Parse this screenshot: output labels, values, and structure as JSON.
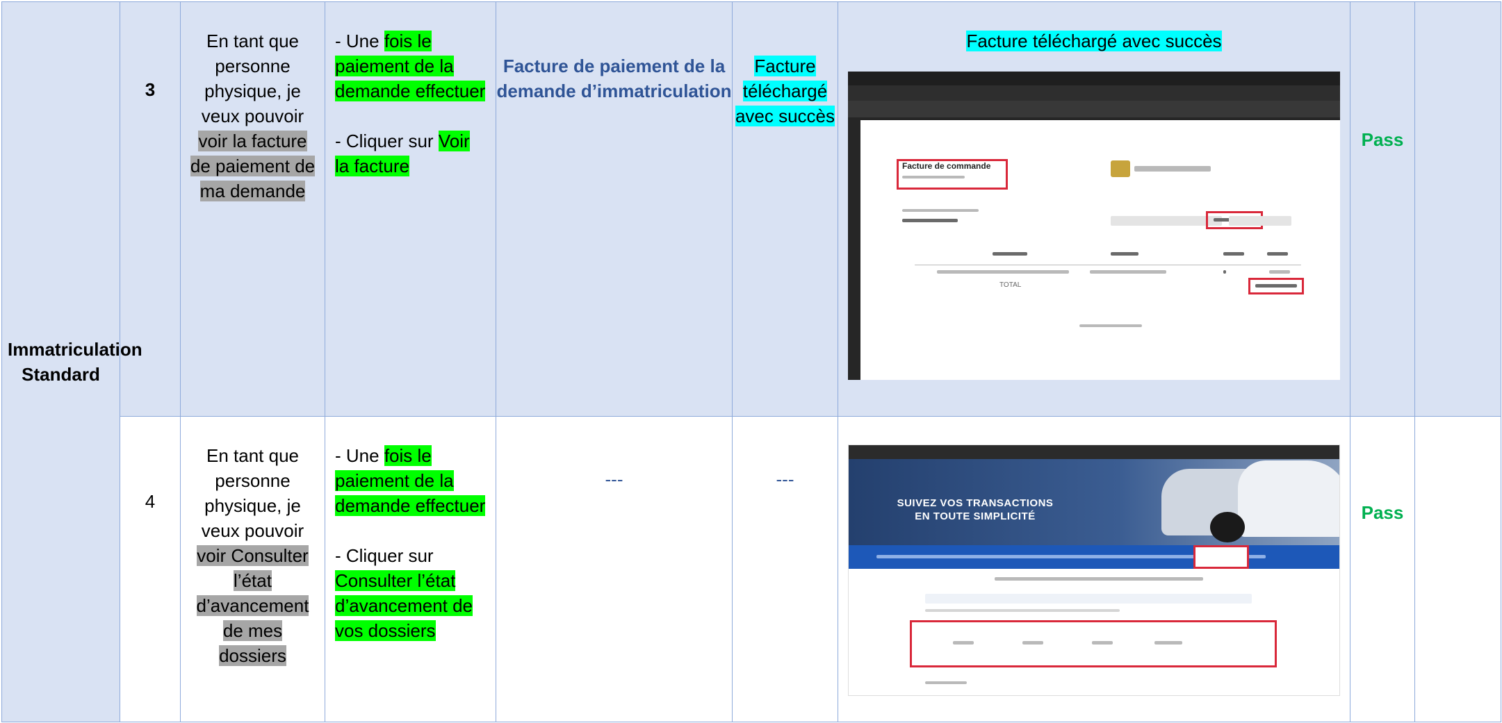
{
  "module": "Immatriculation Standard",
  "rows": [
    {
      "id": "3",
      "story": {
        "p1": "En tant que personne physique, je veux pouvoir ",
        "p2": "voir la facture de paiement de ma demande"
      },
      "steps": {
        "s1a": "- Une ",
        "s1b": "fois le paiement de la demande effectuer",
        "s2a": "- Cliquer sur ",
        "s2b": "Voir la facture"
      },
      "title": "Facture de paiement de la demande d’immatriculation",
      "expected": "Facture téléchargé avec succès",
      "result_caption": "Facture téléchargé avec succès",
      "status": "Pass",
      "comment": ""
    },
    {
      "id": "4",
      "story": {
        "p1": "En tant que personne physique, je veux pouvoir ",
        "p2": "voir Consulter l’état d’avancement de mes dossiers"
      },
      "steps": {
        "s1a": "- Une ",
        "s1b": "fois le paiement de la demande effectuer",
        "s2a": "- Cliquer sur ",
        "s2b": "Consulter l’état d’avancement de vos dossiers"
      },
      "title": "---",
      "expected": "---",
      "status": "Pass",
      "comment": ""
    }
  ],
  "screenshots": {
    "invoice_title": "Facture de commande",
    "invoice_total_label": "TOTAL",
    "banner_text": "SUIVEZ VOS TRANSACTIONS EN TOUTE SIMPLICITÉ"
  },
  "colors": {
    "header_blue": "#2f5496",
    "pass_green": "#00b050",
    "row_bg": "#d9e2f3",
    "border": "#8eaadb"
  }
}
